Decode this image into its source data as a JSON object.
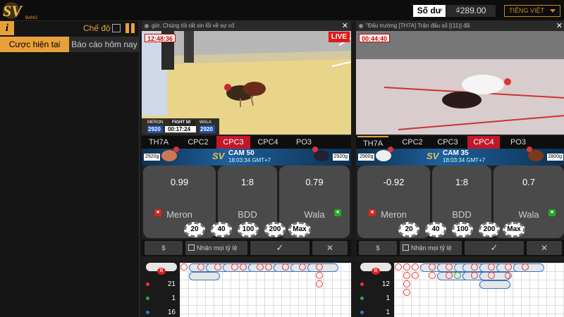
{
  "header": {
    "logo": "SV",
    "balance_label": "Số dư",
    "balance_value": "₫289.00",
    "language": "TIẾNG VIỆT"
  },
  "left": {
    "mode_label": "Chế độ",
    "tab_current": "Cược hiện tại",
    "tab_report": "Báo cáo hôm nay"
  },
  "panels": [
    {
      "title": "giờ. Chúng tôi rất xin lỗi về sự cố",
      "timer": "12:48:36",
      "live": "LIVE",
      "hud": {
        "fight": "FIGHT 50",
        "meron": "MERON",
        "wala": "WALA",
        "meron_val": "2920",
        "wala_val": "2920",
        "clock": "00:17:24"
      },
      "tabs": [
        "TH7A",
        "CPC2",
        "CPC3",
        "CPC4",
        "PO3"
      ],
      "active_tab": 2,
      "cam": "CAM 50",
      "time": "18:03:34 GMT+7",
      "left_weight": "2920g",
      "right_weight": "2920g",
      "meron_odd": "0.99",
      "bdd_odd": "1:8",
      "wala_odd": "0.79",
      "meron": "Meron",
      "bdd": "BDD",
      "wala": "Wala",
      "chips": [
        "20",
        "40",
        "100",
        "200",
        "Max"
      ],
      "accept_all": "Nhận mọi tỷ lệ",
      "road_counts": {
        "red": "21",
        "green": "1",
        "blue": "16"
      }
    },
    {
      "title": "\"Đấu trường [TH7A] Trận đấu số [(11)] đã",
      "timer": "00:44:40",
      "tabs": [
        "TH7A",
        "CPC2",
        "CPC3",
        "CPC4",
        "PO3"
      ],
      "active_tab": 3,
      "cam": "CAM 35",
      "time": "18:03:34 GMT+7",
      "left_weight": "2900g",
      "right_weight": "2800g",
      "meron_odd": "-0.92",
      "bdd_odd": "1:8",
      "wala_odd": "0.7",
      "meron": "Meron",
      "bdd": "BDD",
      "wala": "Wala",
      "chips": [
        "20",
        "40",
        "100",
        "200",
        "Max"
      ],
      "accept_all": "Nhận mọi tỷ lệ",
      "road_counts": {
        "red": "12",
        "green": "1",
        "blue": "1"
      }
    }
  ],
  "road_badge": "B",
  "colors": {
    "accent": "#e8a13a",
    "active_tab": "#c0182a",
    "meron": "#e33",
    "wala": "#37c",
    "draw": "#3a3"
  }
}
